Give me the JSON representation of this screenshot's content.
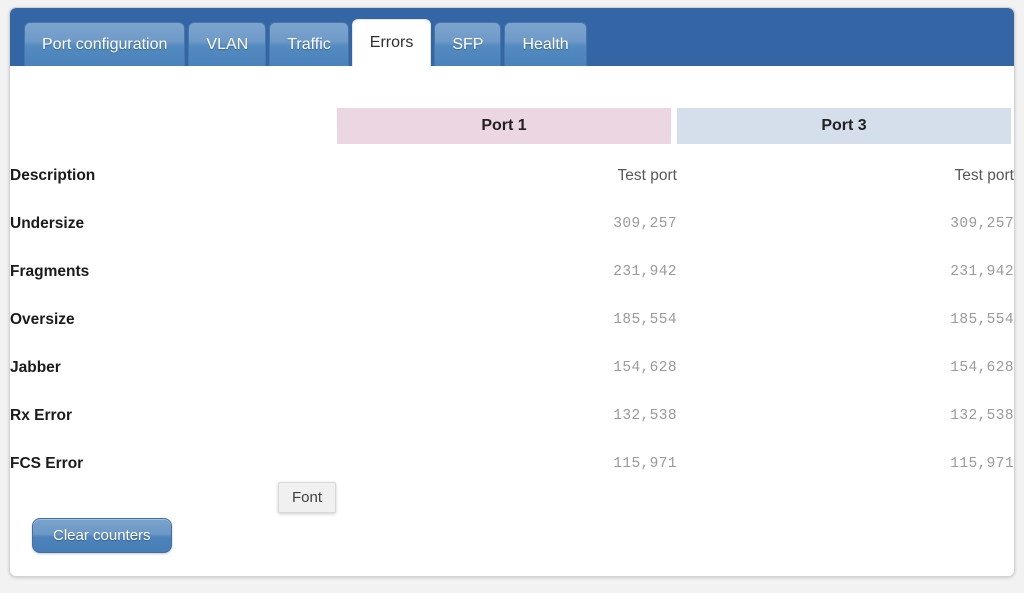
{
  "panel": {
    "tabs": [
      {
        "label": "Port configuration",
        "active": false
      },
      {
        "label": "VLAN",
        "active": false
      },
      {
        "label": "Traffic",
        "active": false
      },
      {
        "label": "Errors",
        "active": true
      },
      {
        "label": "SFP",
        "active": false
      },
      {
        "label": "Health",
        "active": false
      }
    ],
    "colors": {
      "header_bar": "#3465a4",
      "tab_active_bg": "#ffffff",
      "port1_header_bg": "#ecd6e1",
      "port3_header_bg": "#d4dfeb",
      "value_text": "#9a9a9a",
      "label_text": "#1b1b1b",
      "button_blue": "#5a8cc2"
    }
  },
  "table": {
    "columns": [
      {
        "key": "label",
        "label": ""
      },
      {
        "key": "port1",
        "label": "Port 1"
      },
      {
        "key": "port3",
        "label": "Port 3"
      }
    ],
    "rows": [
      {
        "label": "Description",
        "port1": "Test port",
        "port3": "Test port",
        "kind": "text"
      },
      {
        "label": "Undersize",
        "port1": "309,257",
        "port3": "309,257",
        "kind": "count"
      },
      {
        "label": "Fragments",
        "port1": "231,942",
        "port3": "231,942",
        "kind": "count"
      },
      {
        "label": "Oversize",
        "port1": "185,554",
        "port3": "185,554",
        "kind": "count"
      },
      {
        "label": "Jabber",
        "port1": "154,628",
        "port3": "154,628",
        "kind": "count"
      },
      {
        "label": "Rx Error",
        "port1": "132,538",
        "port3": "132,538",
        "kind": "count"
      },
      {
        "label": "FCS Error",
        "port1": "115,971",
        "port3": "115,971",
        "kind": "count"
      }
    ]
  },
  "tooltip": {
    "text": "Font"
  },
  "actions": {
    "clear_counters_label": "Clear counters"
  }
}
